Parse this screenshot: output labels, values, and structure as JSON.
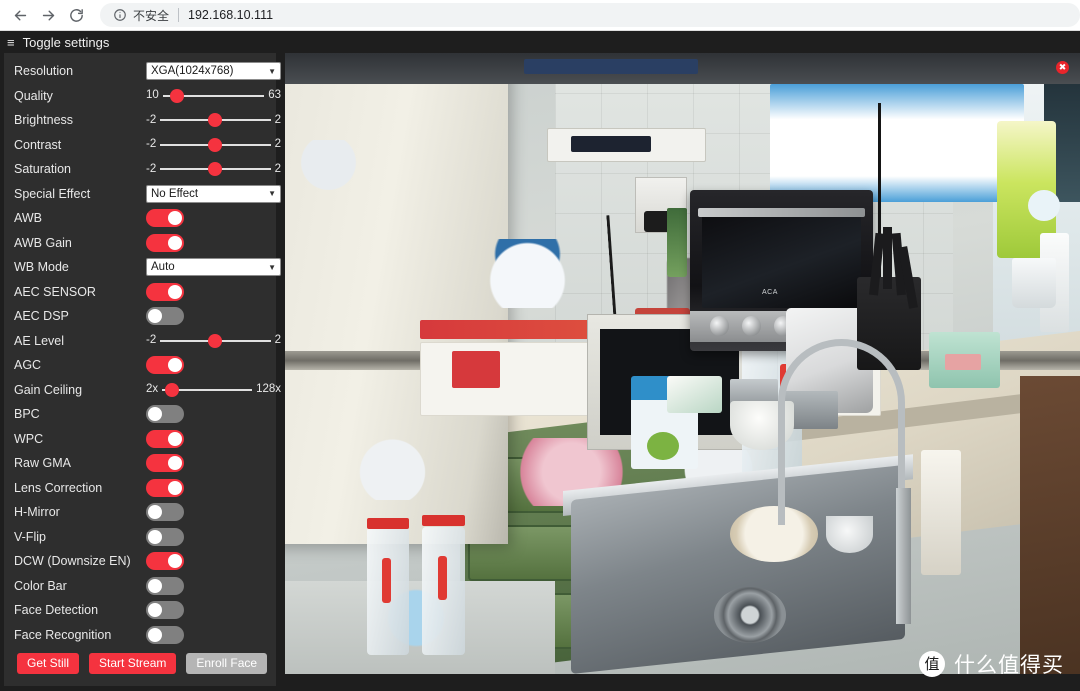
{
  "browser": {
    "back_icon": "back-arrow-icon",
    "forward_icon": "forward-arrow-icon",
    "reload_icon": "reload-icon",
    "info_icon": "info-circle-icon",
    "security_label": "不安全",
    "url": "192.168.10.111"
  },
  "page": {
    "toggle_settings_label": "Toggle settings",
    "hamburger_icon": "≡"
  },
  "settings": {
    "rows": [
      {
        "label": "Resolution",
        "type": "select",
        "value": "XGA(1024x768)",
        "arrow": "▼"
      },
      {
        "label": "Quality",
        "type": "slider",
        "min": "10",
        "max": "63",
        "pct": 14
      },
      {
        "label": "Brightness",
        "type": "slider",
        "min": "-2",
        "max": "2",
        "pct": 50
      },
      {
        "label": "Contrast",
        "type": "slider",
        "min": "-2",
        "max": "2",
        "pct": 50
      },
      {
        "label": "Saturation",
        "type": "slider",
        "min": "-2",
        "max": "2",
        "pct": 50
      },
      {
        "label": "Special Effect",
        "type": "select",
        "value": "No Effect",
        "arrow": "▼"
      },
      {
        "label": "AWB",
        "type": "toggle",
        "state": "on"
      },
      {
        "label": "AWB Gain",
        "type": "toggle",
        "state": "on"
      },
      {
        "label": "WB Mode",
        "type": "select",
        "value": "Auto",
        "arrow": "▼"
      },
      {
        "label": "AEC SENSOR",
        "type": "toggle",
        "state": "on"
      },
      {
        "label": "AEC DSP",
        "type": "toggle",
        "state": "off"
      },
      {
        "label": "AE Level",
        "type": "slider",
        "min": "-2",
        "max": "2",
        "pct": 50
      },
      {
        "label": "AGC",
        "type": "toggle",
        "state": "on"
      },
      {
        "label": "Gain Ceiling",
        "type": "slider",
        "min": "2x",
        "max": "128x",
        "pct": 11
      },
      {
        "label": "BPC",
        "type": "toggle",
        "state": "off"
      },
      {
        "label": "WPC",
        "type": "toggle",
        "state": "on"
      },
      {
        "label": "Raw GMA",
        "type": "toggle",
        "state": "on"
      },
      {
        "label": "Lens Correction",
        "type": "toggle",
        "state": "on"
      },
      {
        "label": "H-Mirror",
        "type": "toggle",
        "state": "off"
      },
      {
        "label": "V-Flip",
        "type": "toggle",
        "state": "off"
      },
      {
        "label": "DCW (Downsize EN)",
        "type": "toggle",
        "state": "on"
      },
      {
        "label": "Color Bar",
        "type": "toggle",
        "state": "off"
      },
      {
        "label": "Face Detection",
        "type": "toggle",
        "state": "off"
      },
      {
        "label": "Face Recognition",
        "type": "toggle",
        "state": "off"
      }
    ],
    "buttons": [
      {
        "label": "Get Still",
        "style": "primary"
      },
      {
        "label": "Start Stream",
        "style": "primary"
      },
      {
        "label": "Enroll Face",
        "style": "disabled"
      }
    ]
  },
  "stream": {
    "close_label": "✖",
    "scene_description": "kitchen camera view"
  },
  "watermark": {
    "logo": "值",
    "text": "什么值得买"
  },
  "colors": {
    "accent_red": "#f5333f",
    "toggle_off": "#808080",
    "panel_bg": "#2e2e2e",
    "page_bg": "#1e1e1e"
  }
}
